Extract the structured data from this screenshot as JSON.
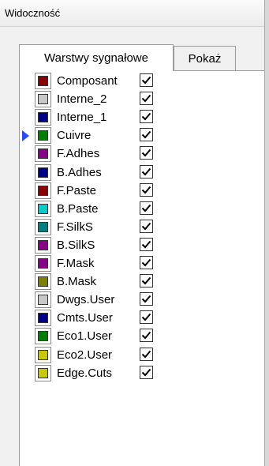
{
  "window": {
    "title": "Widoczność"
  },
  "tabs": [
    {
      "label": "Warstwy sygnałowe",
      "active": true
    },
    {
      "label": "Pokaż",
      "active": false
    }
  ],
  "layers": [
    {
      "name": "Composant",
      "color": "#8b0000",
      "visible": true,
      "active": false
    },
    {
      "name": "Interne_2",
      "color": "#c8c8c8",
      "visible": true,
      "active": false
    },
    {
      "name": "Interne_1",
      "color": "#00008b",
      "visible": true,
      "active": false
    },
    {
      "name": "Cuivre",
      "color": "#008000",
      "visible": true,
      "active": true
    },
    {
      "name": "F.Adhes",
      "color": "#8b008b",
      "visible": true,
      "active": false
    },
    {
      "name": "B.Adhes",
      "color": "#00008b",
      "visible": true,
      "active": false
    },
    {
      "name": "F.Paste",
      "color": "#8b0000",
      "visible": true,
      "active": false
    },
    {
      "name": "B.Paste",
      "color": "#00cccc",
      "visible": true,
      "active": false
    },
    {
      "name": "F.SilkS",
      "color": "#008080",
      "visible": true,
      "active": false
    },
    {
      "name": "B.SilkS",
      "color": "#8b008b",
      "visible": true,
      "active": false
    },
    {
      "name": "F.Mask",
      "color": "#8b008b",
      "visible": true,
      "active": false
    },
    {
      "name": "B.Mask",
      "color": "#808000",
      "visible": true,
      "active": false
    },
    {
      "name": "Dwgs.User",
      "color": "#c8c8c8",
      "visible": true,
      "active": false
    },
    {
      "name": "Cmts.User",
      "color": "#00008b",
      "visible": true,
      "active": false
    },
    {
      "name": "Eco1.User",
      "color": "#008000",
      "visible": true,
      "active": false
    },
    {
      "name": "Eco2.User",
      "color": "#c8c800",
      "visible": true,
      "active": false
    },
    {
      "name": "Edge.Cuts",
      "color": "#c8c800",
      "visible": true,
      "active": false
    }
  ]
}
